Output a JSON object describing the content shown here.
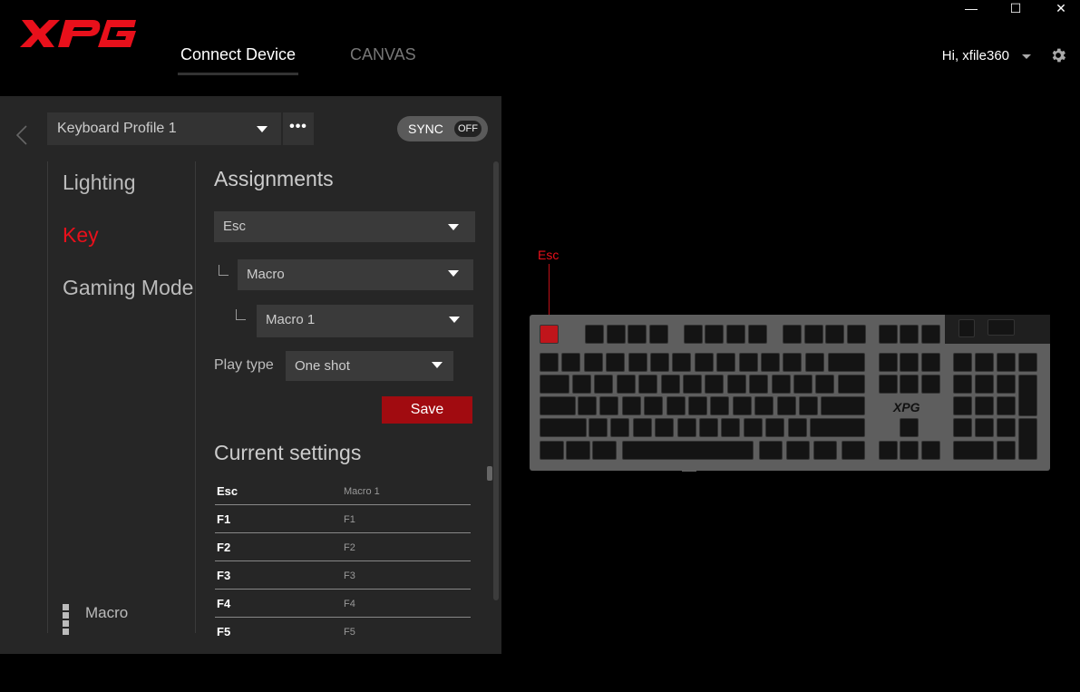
{
  "app": {
    "brand": "XPG",
    "nav_tabs": [
      {
        "label": "Connect Device"
      },
      {
        "label": "CANVAS"
      }
    ],
    "window_controls": {
      "minimize": "—",
      "maximize": "☐",
      "close": "✕"
    },
    "user_greeting": "Hi, xfile360"
  },
  "profile": {
    "selected": "Keyboard Profile 1",
    "more": "•••",
    "sync_label": "SYNC",
    "sync_state": "OFF"
  },
  "side_nav": {
    "items": [
      {
        "label": "Lighting"
      },
      {
        "label": "Key"
      },
      {
        "label": "Gaming Mode"
      }
    ],
    "macro_label": "Macro"
  },
  "assignments": {
    "title": "Assignments",
    "key_select": "Esc",
    "function_select": "Macro",
    "macro_select": "Macro 1",
    "play_type_label": "Play type",
    "play_type_value": "One shot",
    "save_label": "Save"
  },
  "current_settings": {
    "title": "Current settings",
    "rows": [
      {
        "key": "Esc",
        "value": "Macro 1"
      },
      {
        "key": "F1",
        "value": "F1"
      },
      {
        "key": "F2",
        "value": "F2"
      },
      {
        "key": "F3",
        "value": "F3"
      },
      {
        "key": "F4",
        "value": "F4"
      },
      {
        "key": "F5",
        "value": "F5"
      }
    ]
  },
  "keyboard": {
    "selected_key_label": "Esc",
    "logo": "XPG",
    "accent_color": "#e8101b"
  }
}
